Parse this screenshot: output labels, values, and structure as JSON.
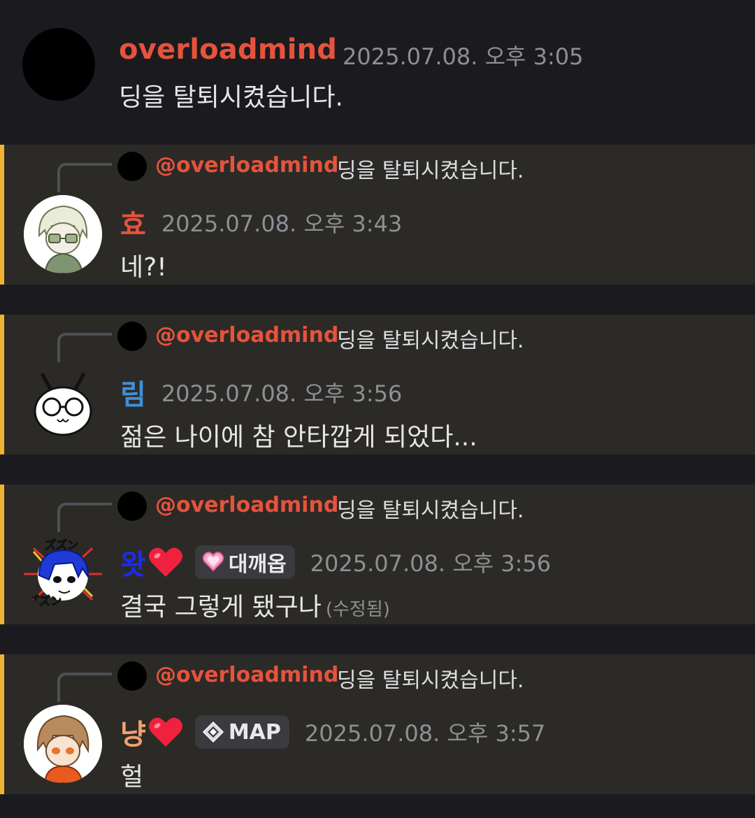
{
  "first_message": {
    "username": "overloadmind",
    "timestamp": "2025.07.08. 오후 3:05",
    "text": "딩을 탈퇴시켰습니다."
  },
  "reply_preview": {
    "mention": "@overloadmind",
    "text": "딩을 탈퇴시켰습니다."
  },
  "replies": [
    {
      "username": "효",
      "name_color": "#e5533d",
      "timestamp": "2025.07.08. 오후 3:43",
      "text": "네?!"
    },
    {
      "username": "림",
      "name_color": "#3f8fd8",
      "timestamp": "2025.07.08. 오후 3:56",
      "text": "젊은 나이에 참 안타깝게 되었다..."
    },
    {
      "username": "왓",
      "name_color": "#1a2cf0",
      "role_tag": "대깨옵",
      "role_icon": "pink-heart-icon",
      "timestamp": "2025.07.08. 오후 3:56",
      "text": "결국 그렇게 됐구나",
      "edited": "(수정됨)"
    },
    {
      "username": "냥",
      "name_color": "#f0a070",
      "role_tag": "MAP",
      "role_icon": "diamond-compass-icon",
      "timestamp": "2025.07.08. 오후 3:57",
      "text": "헐"
    }
  ],
  "colors": {
    "background": "#1b1b1f",
    "highlight": "#2c2a26",
    "mention_bar": "#f0b232",
    "timestamp": "#8e8f96"
  }
}
